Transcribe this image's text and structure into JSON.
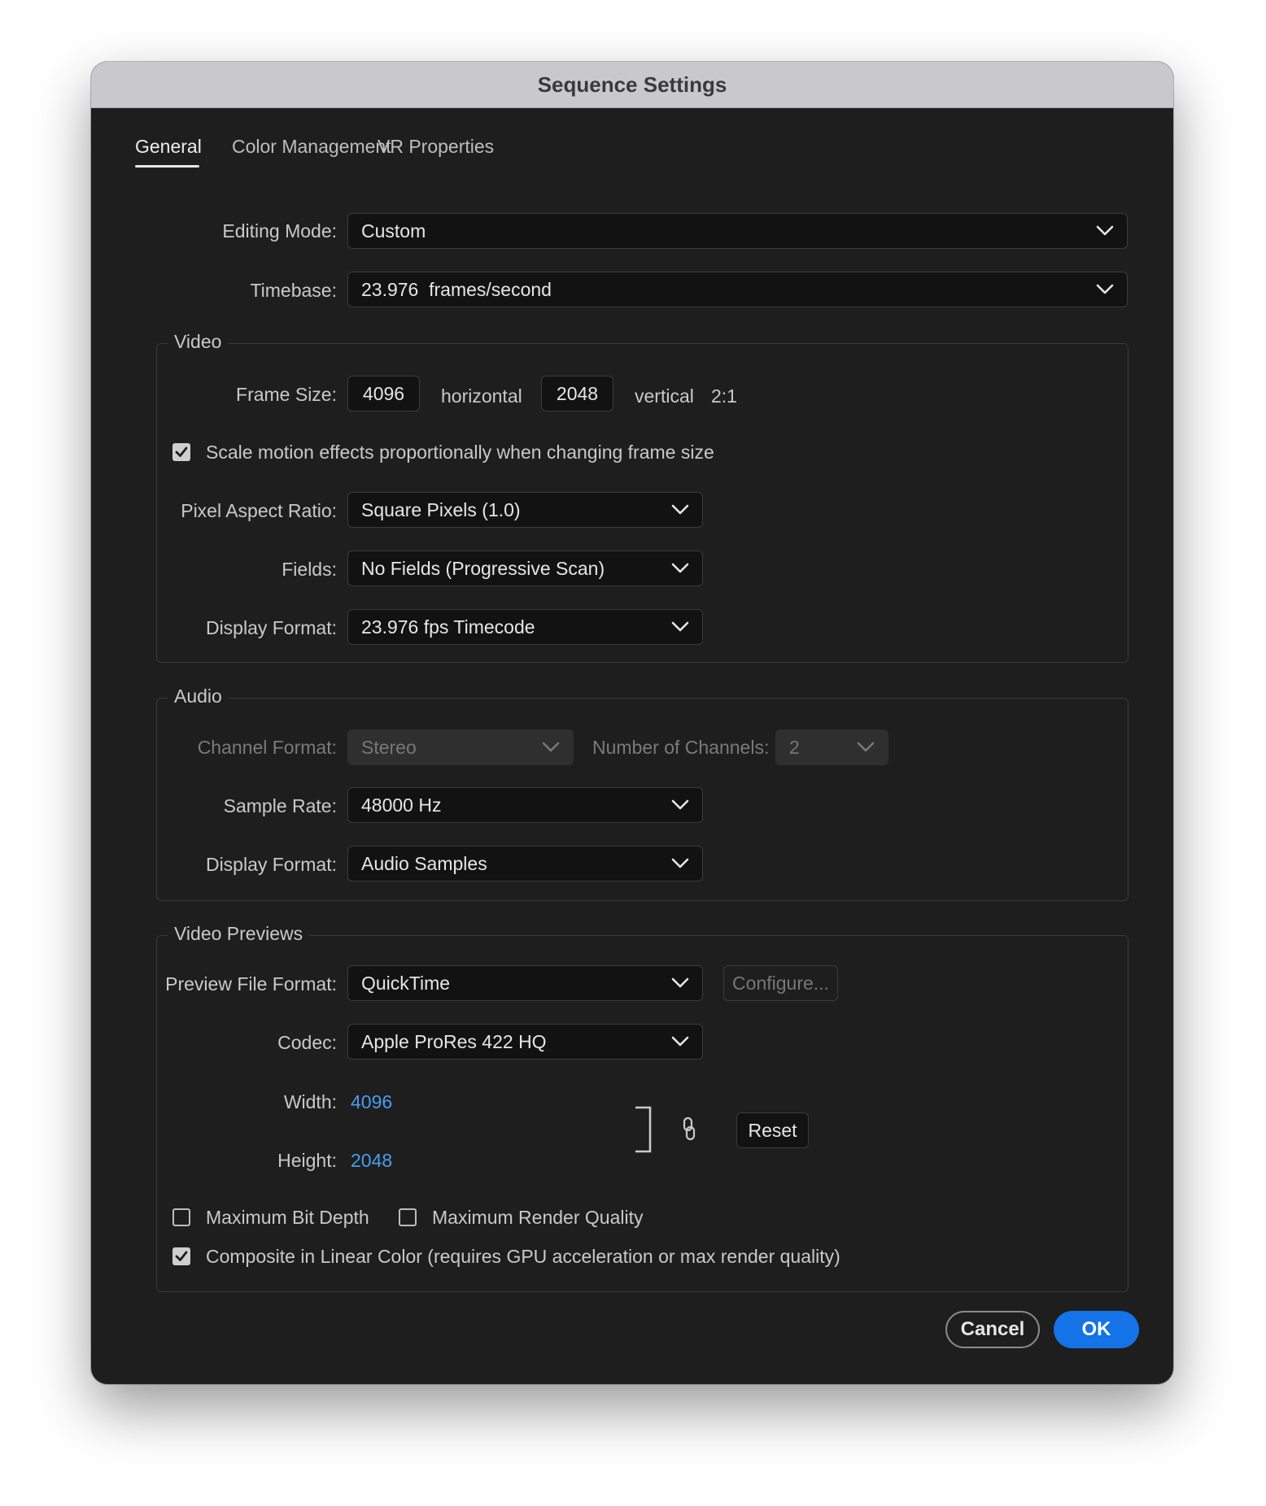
{
  "window": {
    "title": "Sequence Settings"
  },
  "tabs": [
    {
      "label": "General",
      "active": true
    },
    {
      "label": "Color Management",
      "active": false
    },
    {
      "label": "VR Properties",
      "active": false
    }
  ],
  "editing_mode": {
    "label": "Editing Mode:",
    "value": "Custom"
  },
  "timebase": {
    "label": "Timebase:",
    "value": "23.976  frames/second"
  },
  "video": {
    "legend": "Video",
    "frame_size": {
      "label": "Frame Size:",
      "horizontal": "4096",
      "horizontal_label": "horizontal",
      "vertical": "2048",
      "vertical_label": "vertical",
      "ratio": "2:1"
    },
    "scale_motion": {
      "label": "Scale motion effects proportionally when changing frame size",
      "checked": true
    },
    "pixel_aspect_ratio": {
      "label": "Pixel Aspect Ratio:",
      "value": "Square Pixels (1.0)"
    },
    "fields": {
      "label": "Fields:",
      "value": "No Fields (Progressive Scan)"
    },
    "display_format": {
      "label": "Display Format:",
      "value": "23.976 fps Timecode"
    }
  },
  "audio": {
    "legend": "Audio",
    "channel_format": {
      "label": "Channel Format:",
      "value": "Stereo",
      "disabled": true
    },
    "num_channels": {
      "label": "Number of Channels:",
      "value": "2",
      "disabled": true
    },
    "sample_rate": {
      "label": "Sample Rate:",
      "value": "48000 Hz"
    },
    "display_format": {
      "label": "Display Format:",
      "value": "Audio Samples"
    }
  },
  "previews": {
    "legend": "Video Previews",
    "file_format": {
      "label": "Preview File Format:",
      "value": "QuickTime"
    },
    "configure_label": "Configure...",
    "codec": {
      "label": "Codec:",
      "value": "Apple ProRes 422 HQ"
    },
    "width": {
      "label": "Width:",
      "value": "4096"
    },
    "height": {
      "label": "Height:",
      "value": "2048"
    },
    "reset_label": "Reset",
    "max_bit_depth": {
      "label": "Maximum Bit Depth",
      "checked": false
    },
    "max_render_quality": {
      "label": "Maximum Render Quality",
      "checked": false
    },
    "composite_linear": {
      "label": "Composite in Linear Color (requires GPU acceleration or max render quality)",
      "checked": true
    }
  },
  "footer": {
    "cancel_label": "Cancel",
    "ok_label": "OK"
  },
  "colors": {
    "accent": "#1473e6",
    "link": "#4a9cf0",
    "background": "#1e1e1e",
    "titlebar": "#c9c9cd"
  },
  "icons": [
    "chevron-down-icon",
    "checkmark-icon",
    "link-chain-icon",
    "bracket-icon"
  ]
}
